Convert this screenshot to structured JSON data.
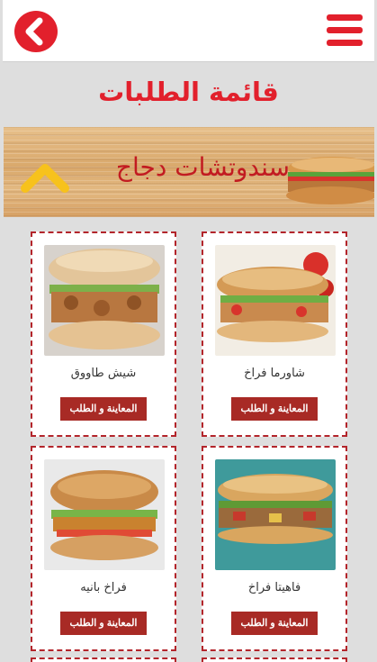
{
  "header": {
    "back_icon": "back-chevron-icon",
    "menu_icon": "hamburger-menu-icon"
  },
  "page": {
    "title": "قائمة الطلبات"
  },
  "category": {
    "title": "سندوتشات دجاج",
    "toggle_icon": "chevron-up-icon"
  },
  "products": [
    {
      "name": "شاورما فراخ",
      "button": "المعاينة و الطلب",
      "image": "chicken-shawarma-sandwich"
    },
    {
      "name": "شيش طاووق",
      "button": "المعاينة و الطلب",
      "image": "shish-tawook-sandwich"
    },
    {
      "name": "فاهيتا فراخ",
      "button": "المعاينة و الطلب",
      "image": "chicken-fajita-sandwich"
    },
    {
      "name": "فراخ بانيه",
      "button": "المعاينة و الطلب",
      "image": "chicken-pane-sandwich"
    }
  ],
  "colors": {
    "brand_red": "#e2202c",
    "button_red": "#a82a25",
    "card_border": "#b3252b",
    "background": "#dedede",
    "chevron_yellow": "#f7c21c"
  }
}
